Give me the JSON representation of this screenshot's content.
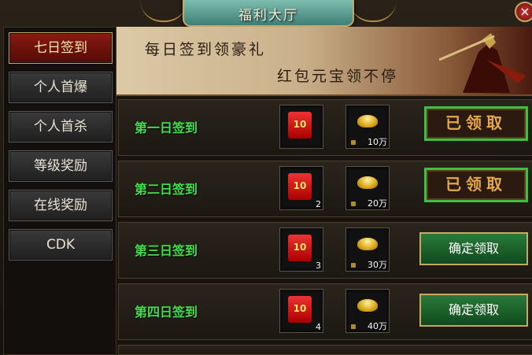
{
  "window": {
    "title": "福利大厅",
    "close_icon": "close-icon"
  },
  "sidebar": {
    "items": [
      {
        "label": "七日签到",
        "active": true
      },
      {
        "label": "个人首爆"
      },
      {
        "label": "个人首杀"
      },
      {
        "label": "等级奖励"
      },
      {
        "label": "在线奖励"
      },
      {
        "label": "CDK"
      }
    ]
  },
  "banner": {
    "line1": "每日签到领豪礼",
    "line2": "红包元宝领不停"
  },
  "rows": [
    {
      "label": "第一日签到",
      "packet_icon_text": "10",
      "packet_qty": "",
      "ingot_qty": "10万",
      "action": "已领取",
      "state": "claimed"
    },
    {
      "label": "第二日签到",
      "packet_icon_text": "10",
      "packet_qty": "2",
      "ingot_qty": "20万",
      "action": "已领取",
      "state": "claimed"
    },
    {
      "label": "第三日签到",
      "packet_icon_text": "10",
      "packet_qty": "3",
      "ingot_qty": "30万",
      "action": "确定领取",
      "state": "claimable"
    },
    {
      "label": "第四日签到",
      "packet_icon_text": "10",
      "packet_qty": "4",
      "ingot_qty": "40万",
      "action": "确定领取",
      "state": "claimable"
    }
  ],
  "colors": {
    "day_label": "#3fe04a",
    "claimed_border": "#39c23f",
    "active_tab": "#8a1a12"
  }
}
